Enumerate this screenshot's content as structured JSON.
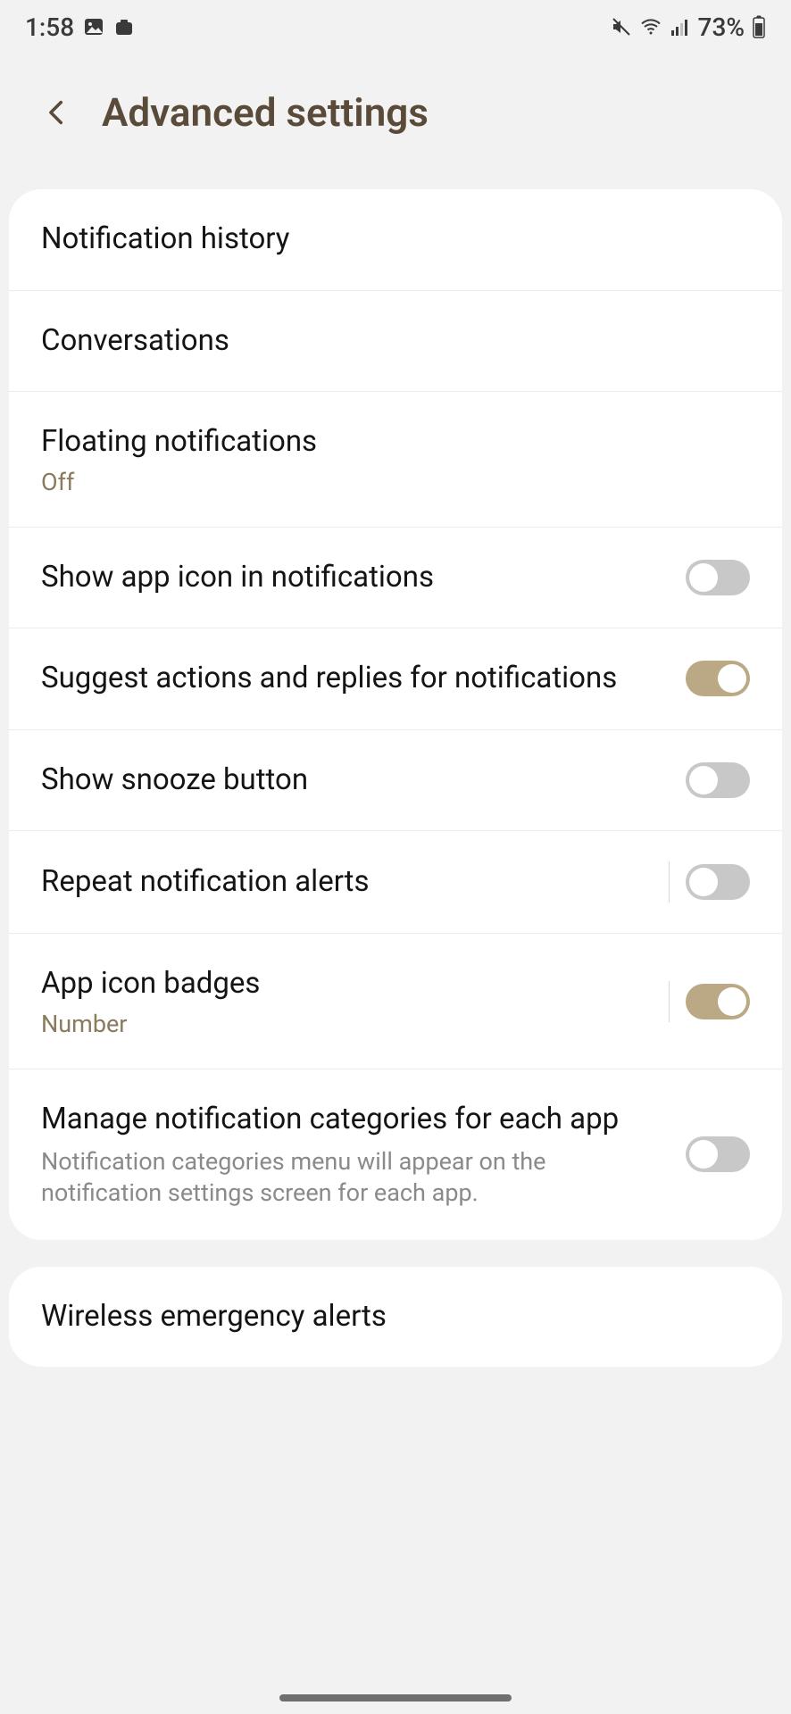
{
  "status": {
    "time": "1:58",
    "battery_pct": "73%"
  },
  "header": {
    "title": "Advanced settings"
  },
  "group1": [
    {
      "title": "Notification history"
    },
    {
      "title": "Conversations"
    },
    {
      "title": "Floating notifications",
      "sub": "Off"
    },
    {
      "title": "Show app icon in notifications",
      "toggle": "off"
    },
    {
      "title": "Suggest actions and replies for notifications",
      "toggle": "on"
    },
    {
      "title": "Show snooze button",
      "toggle": "off"
    },
    {
      "title": "Repeat notification alerts",
      "toggle": "off",
      "divider": true
    },
    {
      "title": "App icon badges",
      "sub": "Number",
      "toggle": "on",
      "divider": true
    },
    {
      "title": "Manage notification categories for each app",
      "desc": "Notification categories menu will appear on the notification settings screen for each app.",
      "toggle": "off"
    }
  ],
  "group2": [
    {
      "title": "Wireless emergency alerts"
    }
  ]
}
